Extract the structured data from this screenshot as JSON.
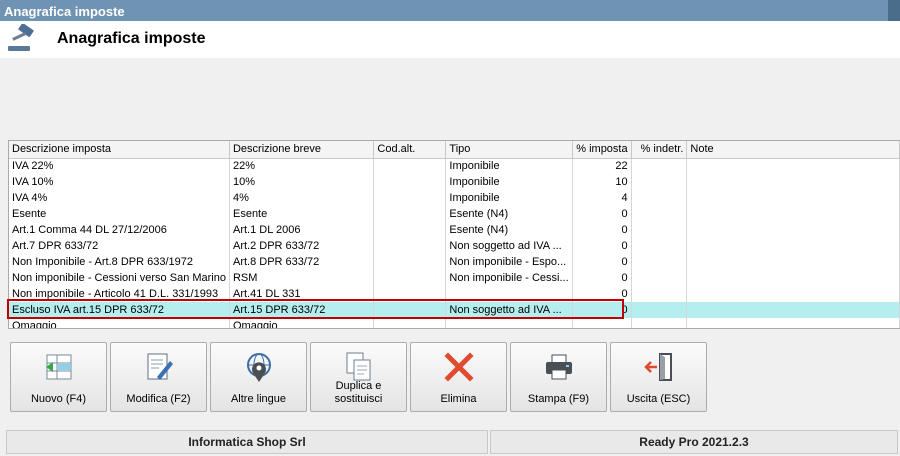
{
  "window": {
    "title": "Anagrafica imposte"
  },
  "header": {
    "title": "Anagrafica imposte",
    "icon": "gavel-icon"
  },
  "grid": {
    "columns": [
      "Descrizione imposta",
      "Descrizione breve",
      "Cod.alt.",
      "Tipo",
      "% imposta",
      "% indetr.",
      "Note"
    ],
    "rows": [
      [
        "IVA 22%",
        "22%",
        "",
        "Imponibile",
        "22",
        "",
        ""
      ],
      [
        "IVA 10%",
        "10%",
        "",
        "Imponibile",
        "10",
        "",
        ""
      ],
      [
        "IVA 4%",
        "4%",
        "",
        "Imponibile",
        "4",
        "",
        ""
      ],
      [
        "Esente",
        "Esente",
        "",
        "Esente (N4)",
        "0",
        "",
        ""
      ],
      [
        "Art.1 Comma 44 DL 27/12/2006",
        "Art.1 DL 2006",
        "",
        "Esente (N4)",
        "0",
        "",
        ""
      ],
      [
        "Art.7 DPR 633/72",
        "Art.2 DPR 633/72",
        "",
        "Non soggetto ad IVA ...",
        "0",
        "",
        ""
      ],
      [
        "Non Imponibile - Art.8 DPR 633/1972",
        "Art.8 DPR 633/72",
        "",
        "Non imponibile - Espo...",
        "0",
        "",
        ""
      ],
      [
        "Non imponibile - Cessioni verso San Marino",
        "RSM",
        "",
        "Non imponibile - Cessi...",
        "0",
        "",
        ""
      ],
      [
        "Non imponibile - Articolo 41 D.L. 331/1993",
        "Art.41 DL 331",
        "",
        "",
        "0",
        "",
        ""
      ],
      [
        "Escluso IVA art.15 DPR 633/72",
        "Art.15 DPR 633/72",
        "",
        "Non soggetto ad IVA ...",
        "0",
        "",
        ""
      ],
      [
        "Omaggio",
        "Omaggio",
        "",
        "",
        "",
        "",
        ""
      ]
    ],
    "selected_row": 9,
    "selection_color": "#b4eeee"
  },
  "toolbar": {
    "buttons": [
      {
        "label": "Nuovo (F4)",
        "icon": "new-record-icon"
      },
      {
        "label": "Modifica (F2)",
        "icon": "edit-document-icon"
      },
      {
        "label": "Altre lingue",
        "icon": "globe-pin-icon"
      },
      {
        "label": "Duplica e sostituisci",
        "icon": "duplicate-icon"
      },
      {
        "label": "Elimina",
        "icon": "delete-x-icon"
      },
      {
        "label": "Stampa (F9)",
        "icon": "printer-icon"
      },
      {
        "label": "Uscita (ESC)",
        "icon": "exit-door-icon"
      }
    ]
  },
  "status": {
    "company": "Informatica Shop Srl",
    "version": "Ready Pro 2021.2.3"
  },
  "colors": {
    "titlebar": "#6f93b3",
    "highlight_border": "#c00000",
    "delete": "#e04a2f"
  }
}
